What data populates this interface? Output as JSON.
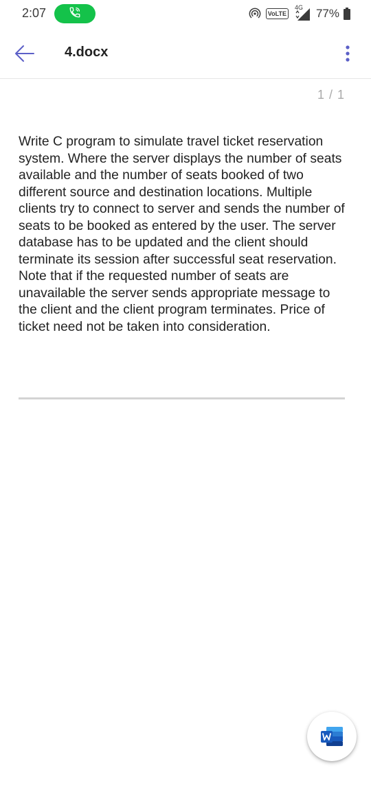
{
  "status_bar": {
    "time": "2:07",
    "call_icon": "phone-in-call-icon",
    "hotspot_icon": "hotspot-icon",
    "volte": "VoLTE",
    "network_type": "4G",
    "signal_icon": "signal-strength-icon",
    "battery_percent": "77%",
    "battery_icon": "battery-icon",
    "call_pill_color": "#14c24a"
  },
  "app_bar": {
    "back_icon": "back-arrow-icon",
    "title": "4.docx",
    "menu_icon": "more-vertical-icon",
    "accent_color": "#5b5fc7"
  },
  "document": {
    "page_indicator": "1 / 1",
    "body_text": "Write C program to simulate travel ticket reservation system. Where the server displays the number of seats available and the number of seats booked of two different source and destination locations. Multiple clients try to connect to server and sends the number of seats to be booked as entered by the user. The server database has to be updated and the client should terminate its session after successful seat reservation. Note that if the requested number of seats are unavailable the server sends appropriate message to the client and the client program terminates. Price of ticket need not be taken into consideration."
  },
  "fab": {
    "icon": "microsoft-word-icon",
    "word_blue": "#185abd"
  }
}
